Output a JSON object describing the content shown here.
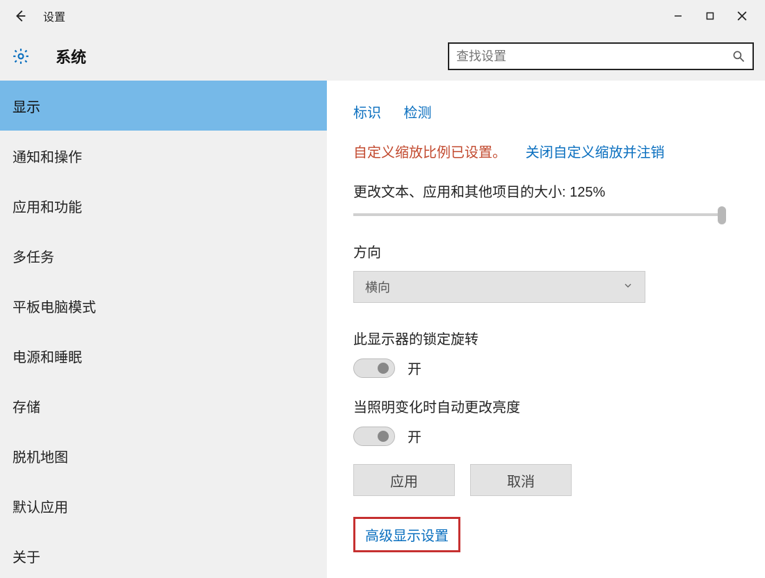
{
  "titlebar": {
    "title": "设置"
  },
  "header": {
    "section_title": "系统",
    "search_placeholder": "查找设置"
  },
  "sidebar": {
    "items": [
      {
        "label": "显示",
        "selected": true
      },
      {
        "label": "通知和操作",
        "selected": false
      },
      {
        "label": "应用和功能",
        "selected": false
      },
      {
        "label": "多任务",
        "selected": false
      },
      {
        "label": "平板电脑模式",
        "selected": false
      },
      {
        "label": "电源和睡眠",
        "selected": false
      },
      {
        "label": "存储",
        "selected": false
      },
      {
        "label": "脱机地图",
        "selected": false
      },
      {
        "label": "默认应用",
        "selected": false
      },
      {
        "label": "关于",
        "selected": false
      }
    ]
  },
  "content": {
    "link_identify": "标识",
    "link_detect": "检测",
    "notice_custom_scale": "自定义缩放比例已设置。",
    "notice_close_link": "关闭自定义缩放并注销",
    "scale_label": "更改文本、应用和其他项目的大小: 125%",
    "scale_value": 125,
    "orientation_label": "方向",
    "orientation_value": "横向",
    "lock_rotation_label": "此显示器的锁定旋转",
    "lock_rotation_state": "开",
    "auto_brightness_label": "当照明变化时自动更改亮度",
    "auto_brightness_state": "开",
    "btn_apply": "应用",
    "btn_cancel": "取消",
    "advanced_link": "高级显示设置"
  }
}
